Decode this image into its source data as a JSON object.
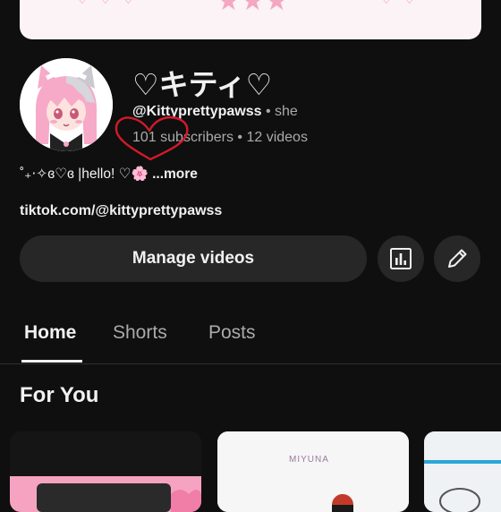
{
  "channel": {
    "name": "♡キティ♡",
    "handle": "@Kittyprettypawss",
    "pronouns_sep": " • ",
    "pronouns": "she",
    "subscribers": "101 subscribers",
    "videos_sep": " • ",
    "videos": "12 videos",
    "bio": "˚₊‧✧ɞ♡ɞ |hello! ♡🌸",
    "bio_more": " ...more",
    "link": "tiktok.com/@kittyprettypawss"
  },
  "actions": {
    "manage_label": "Manage videos",
    "analytics_icon": "analytics-icon",
    "edit_icon": "pencil-icon"
  },
  "tabs": [
    {
      "label": "Home",
      "active": true
    },
    {
      "label": "Shorts",
      "active": false
    },
    {
      "label": "Posts",
      "active": false
    }
  ],
  "sections": {
    "for_you": "For You"
  },
  "thumbnails": {
    "second_caption": "MIYUNA"
  },
  "colors": {
    "background": "#0f0f0f",
    "button_bg": "#272727",
    "text_primary": "#f1f1f1",
    "text_secondary": "#aaaaaa",
    "heart_annotation": "#d11a2a",
    "pink_accent": "#f4a6c3"
  }
}
